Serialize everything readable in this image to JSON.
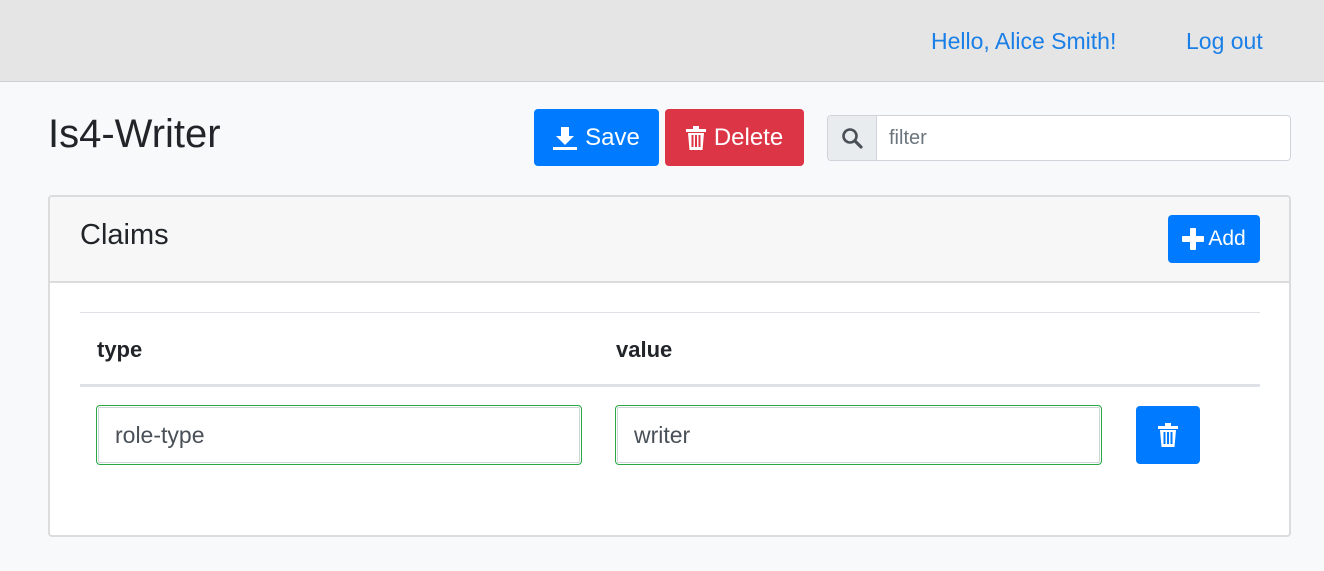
{
  "nav": {
    "greeting": "Hello, Alice Smith!",
    "logout": "Log out"
  },
  "page": {
    "title": "Is4-Writer"
  },
  "toolbar": {
    "save_label": "Save",
    "delete_label": "Delete",
    "filter_placeholder": "filter",
    "filter_value": ""
  },
  "claims": {
    "title": "Claims",
    "add_label": "Add",
    "columns": [
      "type",
      "value"
    ],
    "rows": [
      {
        "type": "role-type",
        "value": "writer"
      }
    ]
  },
  "colors": {
    "primary": "#007bff",
    "danger": "#dc3545",
    "link": "#1a7fe6",
    "valid_border": "#28a745"
  },
  "icons": {
    "save": "download-icon",
    "delete": "trash-icon",
    "search": "search-icon",
    "add": "plus-icon",
    "row_delete": "trash-icon"
  }
}
